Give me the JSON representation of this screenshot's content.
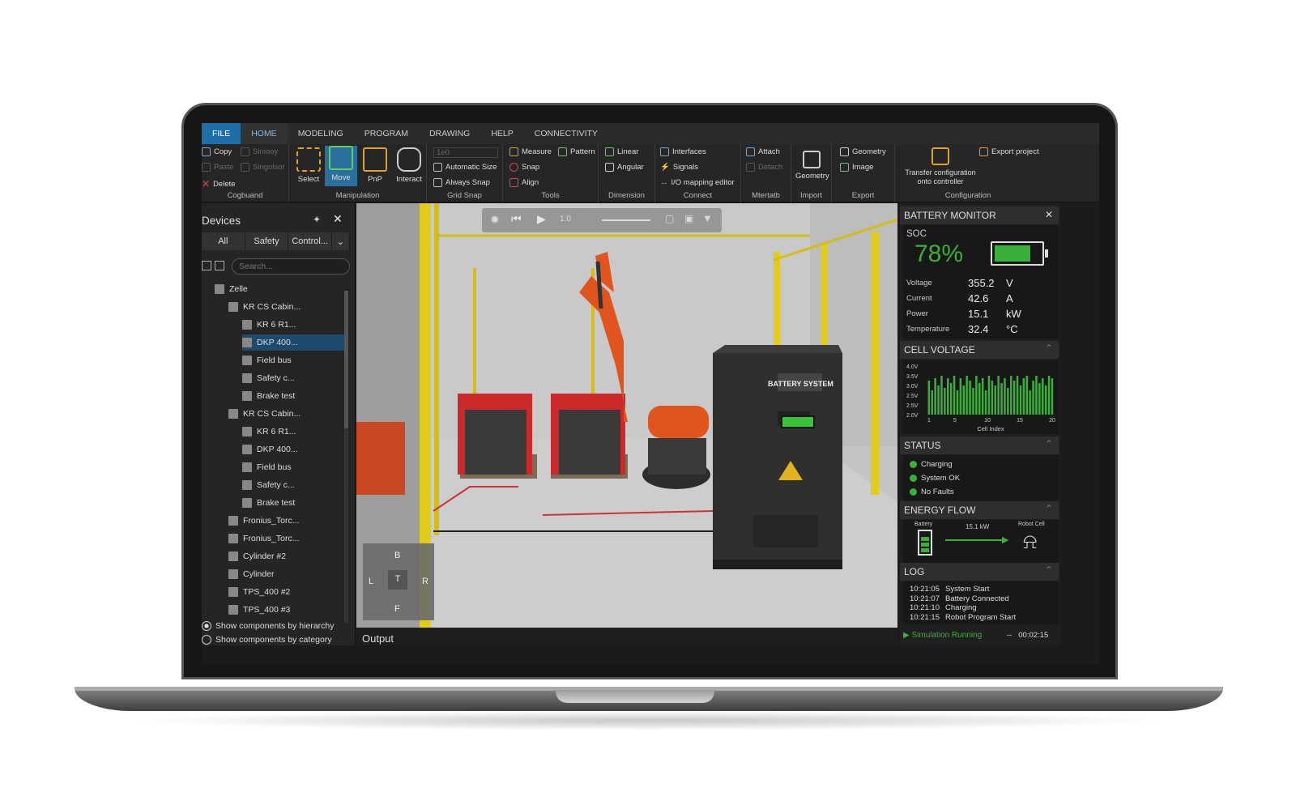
{
  "menu": [
    "FILE",
    "HOME",
    "MODELING",
    "PROGRAM",
    "DRAWING",
    "HELP",
    "CONNECTIVITY"
  ],
  "ribbon": {
    "clipboard": {
      "copy": "Copy",
      "paste": "Paste",
      "delete": "Delete",
      "similar": "Siniooy",
      "singular": "Singolsor",
      "label": "Cogbuand"
    },
    "manipulation": {
      "select": "Select",
      "move": "Move",
      "pnp": "PnP",
      "interact": "Interact",
      "label": "Manipulation"
    },
    "gridsnap": {
      "size_value": "1e0",
      "automatic": "Automatic Size",
      "always": "Always Snap",
      "label": "Grid Snap"
    },
    "tools": {
      "measure": "Measure",
      "pattern": "Pattern",
      "snap": "Snap",
      "align": "Align",
      "label": "Tools"
    },
    "dimension": {
      "linear": "Linear",
      "angular": "Angular",
      "label": "Dimension"
    },
    "connect": {
      "interfaces": "Interfaces",
      "signals": "Signals",
      "io": "I/O mapping editor",
      "label": "Connect"
    },
    "mtertatb": {
      "attach": "Attach",
      "detach": "Detach",
      "label": "Mtertatb"
    },
    "import": {
      "geometry": "Geometry",
      "label": "Import"
    },
    "export": {
      "geometry": "Geometry",
      "image": "Image",
      "label": "Export"
    },
    "configuration": {
      "transfer_line1": "Transfer configuration",
      "transfer_line2": "onto controller",
      "export_project": "Export project",
      "label": "Configuration"
    }
  },
  "devices": {
    "title": "Devices",
    "tabs": [
      "All",
      "Safety",
      "Control..."
    ],
    "search_placeholder": "Search...",
    "tree": [
      {
        "label": "Zelle",
        "level": 0
      },
      {
        "label": "KR CS Cabin...",
        "level": 1
      },
      {
        "label": "KR 6 R1...",
        "level": 2
      },
      {
        "label": "DKP 400...",
        "level": 2
      },
      {
        "label": "Field bus",
        "level": 2
      },
      {
        "label": "Safety c...",
        "level": 2
      },
      {
        "label": "Brake test",
        "level": 2
      },
      {
        "label": "KR CS Cabin...",
        "level": 1
      },
      {
        "label": "KR 6 R1...",
        "level": 2
      },
      {
        "label": "DKP 400...",
        "level": 2
      },
      {
        "label": "Field bus",
        "level": 2
      },
      {
        "label": "Safety c...",
        "level": 2
      },
      {
        "label": "Brake test",
        "level": 2
      },
      {
        "label": "Fronius_Torc...",
        "level": 1
      },
      {
        "label": "Fronius_Torc...",
        "level": 1
      },
      {
        "label": "Cylinder #2",
        "level": 1
      },
      {
        "label": "Cylinder",
        "level": 1
      },
      {
        "label": "TPS_400 #2",
        "level": 1
      },
      {
        "label": "TPS_400 #3",
        "level": 1
      }
    ],
    "selected_index": 3,
    "radio_hierarchy": "Show components by hierarchy",
    "radio_category": "Show components by category"
  },
  "viewport": {
    "speed": "1.0",
    "cabinet_label": "BATTERY SYSTEM",
    "navcube": {
      "top": "B",
      "left": "L",
      "center": "T",
      "right": "R",
      "bottom": "F"
    }
  },
  "output_label": "Output",
  "battery_monitor": {
    "title": "BATTERY MONITOR",
    "soc_label": "SOC",
    "soc_value": "78%",
    "soc_fraction": 0.78,
    "rows": [
      {
        "label": "Voltage",
        "value": "355.2",
        "unit": "V"
      },
      {
        "label": "Current",
        "value": "42.6",
        "unit": "A"
      },
      {
        "label": "Power",
        "value": "15.1",
        "unit": "kW"
      },
      {
        "label": "Temperature",
        "value": "32.4",
        "unit": "°C"
      }
    ],
    "accent": "#3ab03a"
  },
  "cell_voltage": {
    "title": "CELL VOLTAGE",
    "chart_data": {
      "type": "bar",
      "title": "",
      "xlabel": "Cell Index",
      "ylabel": "",
      "y_ticks": [
        "4.0V",
        "3.5V",
        "3.0V",
        "2.5V",
        "2.5V",
        "2.0V"
      ],
      "x_ticks": [
        "1",
        "5",
        "10",
        "15",
        "20"
      ],
      "ylim": [
        2.0,
        4.0
      ],
      "x": [
        1,
        2,
        3,
        4,
        5,
        6,
        7,
        8,
        9,
        10,
        11,
        12,
        13,
        14,
        15,
        16,
        17,
        18,
        19,
        20,
        21,
        22,
        23,
        24,
        25,
        26,
        27,
        28,
        29,
        30,
        31,
        32,
        33,
        34,
        35,
        36,
        37,
        38,
        39,
        40
      ],
      "values": [
        3.4,
        3.0,
        3.5,
        3.2,
        3.6,
        3.1,
        3.5,
        3.3,
        3.6,
        3.0,
        3.5,
        3.2,
        3.6,
        3.4,
        3.1,
        3.6,
        3.3,
        3.5,
        3.0,
        3.6,
        3.4,
        3.2,
        3.6,
        3.3,
        3.5,
        3.1,
        3.6,
        3.4,
        3.6,
        3.2,
        3.5,
        3.6,
        3.0,
        3.4,
        3.6,
        3.3,
        3.5,
        3.2,
        3.6,
        3.5
      ]
    }
  },
  "status": {
    "title": "STATUS",
    "items": [
      "Charging",
      "System OK",
      "No Faults"
    ]
  },
  "energy_flow": {
    "title": "ENERGY FLOW",
    "from": "Battery",
    "power": "15.1 kW",
    "to": "Robot Cell"
  },
  "log": {
    "title": "LOG",
    "entries": [
      {
        "time": "10:21:05",
        "text": "System Start"
      },
      {
        "time": "10:21:07",
        "text": "Battery Connected"
      },
      {
        "time": "10:21:10",
        "text": "Charging"
      },
      {
        "time": "10:21:15",
        "text": "Robot Program Start"
      }
    ]
  },
  "footer": {
    "status": "Simulation Running",
    "elapsed": "00:02:15"
  }
}
